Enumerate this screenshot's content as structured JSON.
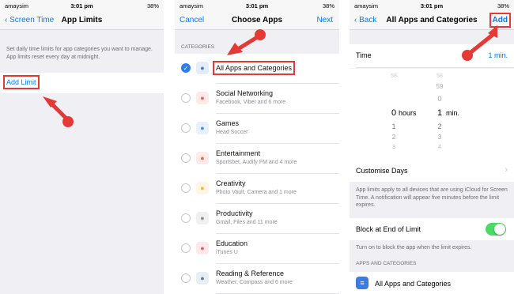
{
  "status": {
    "carrier": "amaysim",
    "time": "3:01 pm",
    "battery": "38%"
  },
  "p1": {
    "back": "Screen Time",
    "title": "App Limits",
    "description": "Set daily time limits for app categories you want to manage. App limits reset every day at midnight.",
    "add_limit": "Add Limit"
  },
  "p2": {
    "cancel": "Cancel",
    "title": "Choose Apps",
    "next": "Next",
    "section": "CATEGORIES",
    "rows": [
      {
        "title": "All Apps and Categories",
        "sub": "",
        "icon": "stack-icon",
        "color": "#3d7be0"
      },
      {
        "title": "Social Networking",
        "sub": "Facebook, Viber and 6 more",
        "icon": "chat-icon",
        "color": "#f0625a"
      },
      {
        "title": "Games",
        "sub": "Head Soccer",
        "icon": "rocket-icon",
        "color": "#4a90e2"
      },
      {
        "title": "Entertainment",
        "sub": "Sportsbet, Audify FM and 4 more",
        "icon": "popcorn-icon",
        "color": "#e86a4a"
      },
      {
        "title": "Creativity",
        "sub": "Photo Vault, Camera and 1 more",
        "icon": "brush-icon",
        "color": "#f6b233"
      },
      {
        "title": "Productivity",
        "sub": "Gmail, Files and 11 more",
        "icon": "pen-icon",
        "color": "#8e8e93"
      },
      {
        "title": "Education",
        "sub": "iTunes U",
        "icon": "globe-icon",
        "color": "#e85c6a"
      },
      {
        "title": "Reading & Reference",
        "sub": "Weather, Compass and 6 more",
        "icon": "book-icon",
        "color": "#5a7fa8"
      }
    ]
  },
  "p3": {
    "back": "Back",
    "title": "All Apps and Categories",
    "add": "Add",
    "time_label": "Time",
    "time_value": "1 min.",
    "picker_hours": [
      "58",
      "59",
      "0",
      "1",
      "2",
      "3"
    ],
    "picker_mins": [
      "59",
      "0",
      "1",
      "2",
      "3"
    ],
    "hours_label": "hours",
    "selected_hours": "0",
    "selected_min": "1",
    "min_label": "min.",
    "customise": "Customise Days",
    "note1": "App limits apply to all devices that are using iCloud for Screen Time. A notification will appear five minutes before the limit expires.",
    "block_label": "Block at End of Limit",
    "note2": "Turn on to block the app when the limit expires.",
    "section": "APPS AND CATEGORIES",
    "app_row": "All Apps and Categories"
  }
}
